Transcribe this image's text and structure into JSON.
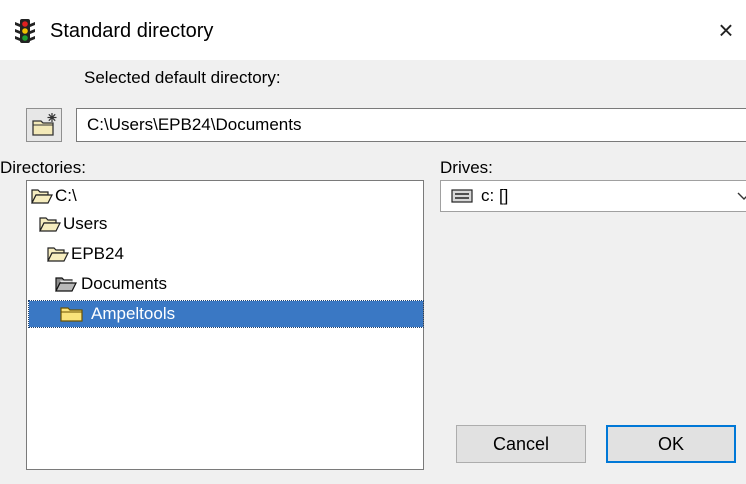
{
  "window": {
    "title": "Standard directory",
    "close_glyph": "×",
    "icon": "traffic-light-icon"
  },
  "selected_dir": {
    "label": "Selected default directory:",
    "value": "C:\\Users\\EPB24\\Documents",
    "new_dir_icon": "new-folder-icon"
  },
  "directories": {
    "label": "Directories:",
    "items": [
      {
        "label": "C:\\",
        "icon": "open-folder-icon",
        "selected": false
      },
      {
        "label": "Users",
        "icon": "open-folder-icon",
        "selected": false
      },
      {
        "label": "EPB24",
        "icon": "open-folder-icon",
        "selected": false
      },
      {
        "label": "Documents",
        "icon": "open-folder-icon",
        "selected": false
      },
      {
        "label": "Ampeltools",
        "icon": "folder-icon",
        "selected": true
      }
    ]
  },
  "drives": {
    "label": "Drives:",
    "selected": "c: []",
    "icon": "drive-icon"
  },
  "buttons": {
    "cancel": "Cancel",
    "ok": "OK"
  },
  "colors": {
    "selection": "#3a78c4",
    "default_button_border": "#0078d7",
    "dialog_background": "#f0f0f0"
  }
}
